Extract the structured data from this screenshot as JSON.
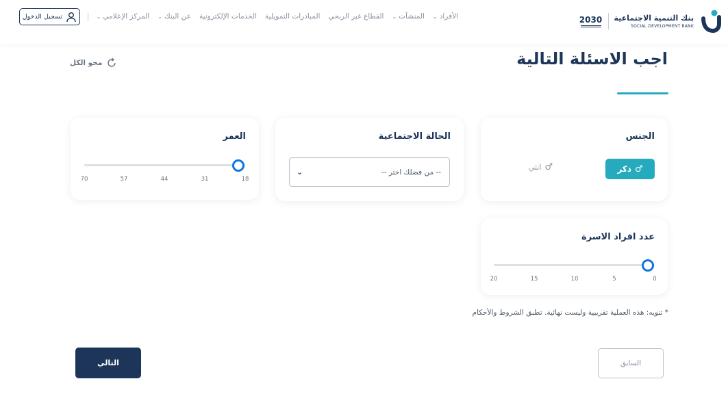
{
  "header": {
    "logo": {
      "name_ar": "بنك التنمية الاجتماعية",
      "name_en": "SOCIAL DEVELOPMENT BANK",
      "vision_text": "2030"
    },
    "nav": [
      {
        "label": "الأفراد",
        "has_dropdown": true
      },
      {
        "label": "المنشآت",
        "has_dropdown": true
      },
      {
        "label": "القطاع غير الربحي",
        "has_dropdown": false
      },
      {
        "label": "المبادرات التمويلية",
        "has_dropdown": false
      },
      {
        "label": "الخدمات الإلكترونية",
        "has_dropdown": false
      },
      {
        "label": "عن البنك",
        "has_dropdown": true
      },
      {
        "label": "المركز الإعلامي",
        "has_dropdown": true
      }
    ],
    "login_label": "تسجيل الدخول"
  },
  "page": {
    "title": "اجب الاسئلة التالية",
    "clear_all": "محو الكل"
  },
  "gender": {
    "label": "الجنس",
    "options": [
      {
        "label": "ذكر",
        "icon": "male-icon",
        "selected": true
      },
      {
        "label": "انثي",
        "icon": "male-icon",
        "selected": false
      }
    ]
  },
  "marital_status": {
    "label": "الحالة الاجتماعية",
    "selected_value": "-- من فضلك اختر --"
  },
  "age": {
    "label": "العمر",
    "ticks": [
      "18",
      "31",
      "44",
      "57",
      "70"
    ],
    "value": 18
  },
  "family_size": {
    "label": "عدد افراد الاسرة",
    "ticks": [
      "0",
      "5",
      "10",
      "15",
      "20"
    ],
    "value": 0
  },
  "notice": "* تنويه: هذه العملية تقريبية وليست نهائية. تطبق الشروط والأحكام",
  "actions": {
    "prev_label": "السابق",
    "next_label": "التالي"
  },
  "colors": {
    "primary": "#1d3559",
    "accent": "#26aabe",
    "slider": "#0b76e0"
  }
}
